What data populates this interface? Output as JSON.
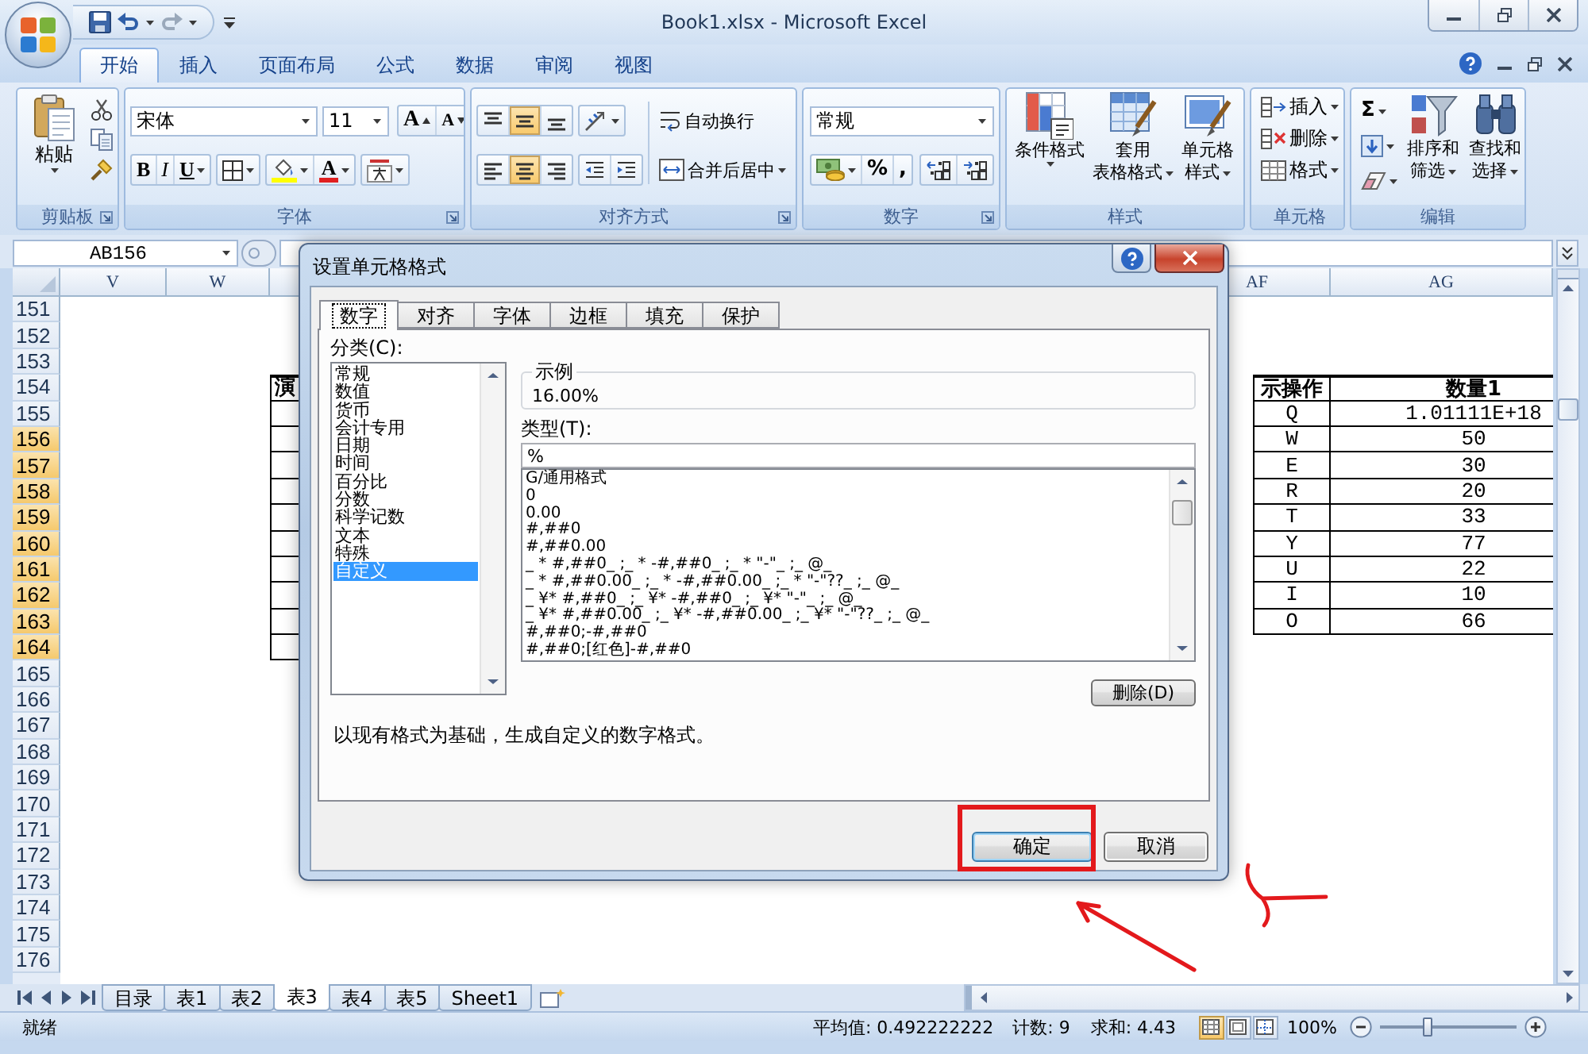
{
  "window": {
    "title": "Book1.xlsx - Microsoft Excel"
  },
  "ribbon_tabs": [
    {
      "label": "开始",
      "selected": true
    },
    {
      "label": "插入",
      "selected": false
    },
    {
      "label": "页面布局",
      "selected": false
    },
    {
      "label": "公式",
      "selected": false
    },
    {
      "label": "数据",
      "selected": false
    },
    {
      "label": "审阅",
      "selected": false
    },
    {
      "label": "视图",
      "selected": false
    }
  ],
  "ribbon": {
    "clipboard": {
      "label": "剪贴板",
      "paste": "粘贴"
    },
    "font": {
      "label": "字体",
      "font_name": "宋体",
      "font_size": "11",
      "grow": "A",
      "shrink": "A",
      "bold": "B",
      "italic": "I",
      "underline": "U",
      "font_color": "A"
    },
    "alignment": {
      "label": "对齐方式",
      "vertical": [
        {
          "selected": false
        },
        {
          "selected": true
        },
        {
          "selected": false
        }
      ],
      "horizontal": [
        {
          "selected": false
        },
        {
          "selected": true
        },
        {
          "selected": false
        }
      ],
      "wrap_text": "自动换行",
      "merge_center": "合并后居中"
    },
    "number": {
      "label": "数字",
      "format": "常规",
      "percent": "%",
      "comma": ","
    },
    "styles": {
      "label": "样式",
      "buttons": [
        {
          "lines": [
            "条件格式"
          ]
        },
        {
          "lines": [
            "套用",
            "表格格式"
          ]
        },
        {
          "lines": [
            "单元格",
            "样式"
          ]
        }
      ]
    },
    "cells": {
      "label": "单元格",
      "buttons": [
        "插入",
        "删除",
        "格式"
      ]
    },
    "editing": {
      "label": "编辑",
      "sum": "Σ",
      "buttons": [
        {
          "lines": [
            "排序和",
            "筛选"
          ]
        },
        {
          "lines": [
            "查找和",
            "选择"
          ]
        }
      ]
    }
  },
  "formula_bar": {
    "name_box": "AB156"
  },
  "sheet": {
    "columns_left": [
      "V",
      "W"
    ],
    "columns_right": [
      "AF",
      "AG"
    ],
    "rows": [
      {
        "number": "151",
        "selected": false,
        "kind": "plain"
      },
      {
        "number": "152",
        "selected": false,
        "kind": "plain"
      },
      {
        "number": "153",
        "selected": false,
        "kind": "plain"
      },
      {
        "number": "154",
        "selected": false,
        "kind": "header",
        "left": "演",
        "af": "示操作",
        "ag": "数量1"
      },
      {
        "number": "155",
        "selected": false,
        "kind": "data",
        "af": "Q",
        "ag": "1.01111E+18"
      },
      {
        "number": "156",
        "selected": true,
        "kind": "data",
        "af": "W",
        "ag": "50"
      },
      {
        "number": "157",
        "selected": true,
        "kind": "data",
        "af": "E",
        "ag": "30"
      },
      {
        "number": "158",
        "selected": true,
        "kind": "data",
        "af": "R",
        "ag": "20"
      },
      {
        "number": "159",
        "selected": true,
        "kind": "data",
        "af": "T",
        "ag": "33"
      },
      {
        "number": "160",
        "selected": true,
        "kind": "data",
        "af": "Y",
        "ag": "77"
      },
      {
        "number": "161",
        "selected": true,
        "kind": "data",
        "af": "U",
        "ag": "22"
      },
      {
        "number": "162",
        "selected": true,
        "kind": "data",
        "af": "I",
        "ag": "10"
      },
      {
        "number": "163",
        "selected": true,
        "kind": "data",
        "af": "O",
        "ag": "66"
      },
      {
        "number": "164",
        "selected": true,
        "kind": "edge"
      },
      {
        "number": "165",
        "selected": false,
        "kind": "plain"
      },
      {
        "number": "166",
        "selected": false,
        "kind": "plain"
      },
      {
        "number": "167",
        "selected": false,
        "kind": "plain"
      },
      {
        "number": "168",
        "selected": false,
        "kind": "plain"
      },
      {
        "number": "169",
        "selected": false,
        "kind": "plain"
      },
      {
        "number": "170",
        "selected": false,
        "kind": "plain"
      },
      {
        "number": "171",
        "selected": false,
        "kind": "plain"
      },
      {
        "number": "172",
        "selected": false,
        "kind": "plain"
      },
      {
        "number": "173",
        "selected": false,
        "kind": "plain"
      },
      {
        "number": "174",
        "selected": false,
        "kind": "plain"
      },
      {
        "number": "175",
        "selected": false,
        "kind": "plain"
      },
      {
        "number": "176",
        "selected": false,
        "kind": "plain"
      }
    ]
  },
  "sheet_tabs": [
    {
      "label": "目录",
      "selected": false
    },
    {
      "label": "表1",
      "selected": false
    },
    {
      "label": "表2",
      "selected": false
    },
    {
      "label": "表3",
      "selected": true
    },
    {
      "label": "表4",
      "selected": false
    },
    {
      "label": "表5",
      "selected": false
    },
    {
      "label": "Sheet1",
      "selected": false
    }
  ],
  "status_bar": {
    "ready": "就绪",
    "average": "平均值: 0.492222222",
    "count": "计数: 9",
    "sum": "求和: 4.43",
    "views": [
      {
        "selected": true
      },
      {
        "selected": false
      },
      {
        "selected": false
      }
    ],
    "zoom": "100%",
    "zoom_slider": {
      "level": 0.35
    }
  },
  "dialog": {
    "title": "设置单元格格式",
    "tabs": [
      {
        "label": "数字",
        "selected": true
      },
      {
        "label": "对齐",
        "selected": false
      },
      {
        "label": "字体",
        "selected": false
      },
      {
        "label": "边框",
        "selected": false
      },
      {
        "label": "填充",
        "selected": false
      },
      {
        "label": "保护",
        "selected": false
      }
    ],
    "category_label": "分类(C):",
    "categories": [
      {
        "label": "常规",
        "selected": false
      },
      {
        "label": "数值",
        "selected": false
      },
      {
        "label": "货币",
        "selected": false
      },
      {
        "label": "会计专用",
        "selected": false
      },
      {
        "label": "日期",
        "selected": false
      },
      {
        "label": "时间",
        "selected": false
      },
      {
        "label": "百分比",
        "selected": false
      },
      {
        "label": "分数",
        "selected": false
      },
      {
        "label": "科学记数",
        "selected": false
      },
      {
        "label": "文本",
        "selected": false
      },
      {
        "label": "特殊",
        "selected": false
      },
      {
        "label": "自定义",
        "selected": true
      }
    ],
    "sample_label": "示例",
    "sample_value": "16.00%",
    "type_label": "类型(T):",
    "type_value": "%",
    "formats": [
      "G/通用格式",
      "0",
      "0.00",
      "#,##0",
      "#,##0.00",
      "_ * #,##0_ ;_ * -#,##0_ ;_ * \"-\"_ ;_ @_",
      "_ * #,##0.00_ ;_ * -#,##0.00_ ;_ * \"-\"??_ ;_ @_",
      "_ ¥* #,##0_ ;_ ¥* -#,##0_ ;_ ¥* \"-\"_ ;_ @_",
      "_ ¥* #,##0.00_ ;_ ¥* -#,##0.00_ ;_ ¥* \"-\"??_ ;_ @_",
      "#,##0;-#,##0",
      "#,##0;[红色]-#,##0"
    ],
    "delete_button": "删除(D)",
    "description": "以现有格式为基础，生成自定义的数字格式。",
    "buttons": [
      {
        "label": "确定",
        "default": true
      },
      {
        "label": "取消",
        "default": false
      }
    ]
  },
  "annotations": [
    {
      "kind": "highlight-box"
    },
    {
      "kind": "arrow"
    },
    {
      "kind": "stroke"
    }
  ]
}
